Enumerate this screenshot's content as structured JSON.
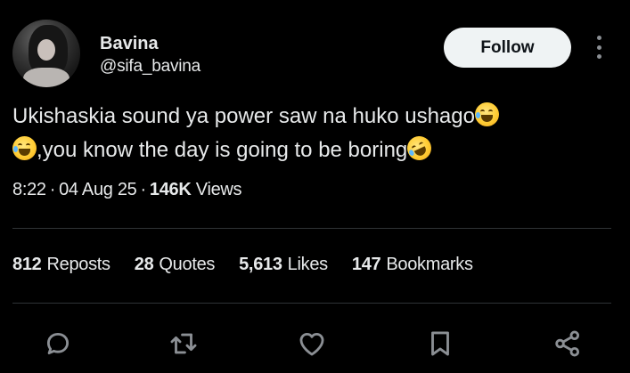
{
  "author": {
    "name": "Bavina",
    "handle": "@sifa_bavina"
  },
  "follow_label": "Follow",
  "tweet": {
    "line1_text": "Ukishaskia sound ya power saw na huko ushago",
    "line2_text": ",you know the day is going to be boring",
    "emojis": [
      "face-with-tears-of-joy",
      "face-with-tears-of-joy",
      "rolling-on-the-floor-laughing"
    ]
  },
  "meta": {
    "time": "8:22",
    "date": "04 Aug 25",
    "views_count": "146K",
    "views_label": "Views"
  },
  "stats": [
    {
      "count": "812",
      "label": "Reposts"
    },
    {
      "count": "28",
      "label": "Quotes"
    },
    {
      "count": "5,613",
      "label": "Likes"
    },
    {
      "count": "147",
      "label": "Bookmarks"
    }
  ],
  "actions": [
    "reply-icon",
    "retweet-icon",
    "like-icon",
    "bookmark-icon",
    "share-icon"
  ],
  "colors": {
    "background": "#000000",
    "text": "#e7e9ea",
    "icon": "#8b8f94",
    "follow_bg": "#eff3f4",
    "follow_text": "#0f1419",
    "divider": "#2f3336"
  }
}
